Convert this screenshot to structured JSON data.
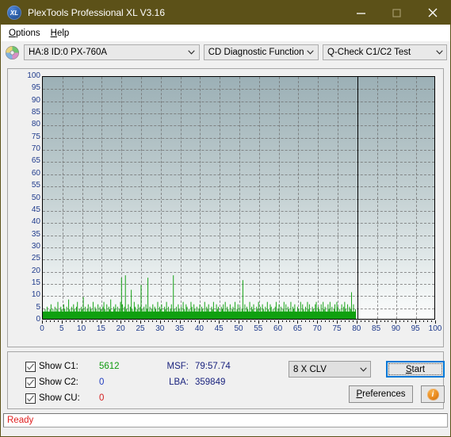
{
  "window": {
    "title": "PlexTools Professional XL V3.16",
    "app_icon": "XL",
    "icon_name": "plextools-xl-icon",
    "titlebar_color": "#5c5118",
    "controls": {
      "minimize": "minimize-icon",
      "maximize": "maximize-icon",
      "close": "close-icon"
    }
  },
  "menu": {
    "items": [
      {
        "label": "Options",
        "accel": "O",
        "rest": "ptions"
      },
      {
        "label": "Help",
        "accel": "H",
        "rest": "elp"
      }
    ]
  },
  "selectors": {
    "disc_icon": "cd-disc-icon",
    "drive": "HA:8 ID:0  PX-760A",
    "function": "CD Diagnostic Functions",
    "test": "Q-Check C1/C2 Test"
  },
  "controls": {
    "checkboxes": [
      {
        "label": "Show C1:",
        "checked": true,
        "value": "5612",
        "color": "#0f9b0f"
      },
      {
        "label": "Show C2:",
        "checked": true,
        "value": "0",
        "color": "#1f3bbf"
      },
      {
        "label": "Show CU:",
        "checked": true,
        "value": "0",
        "color": "#d42020"
      }
    ],
    "readouts": [
      {
        "key": "MSF:",
        "value": "79:57.74"
      },
      {
        "key": "LBA:",
        "value": "359849"
      }
    ],
    "speed": "8 X CLV",
    "start_label": "Start",
    "start_accel": "S",
    "preferences_label": "Preferences",
    "preferences_accel": "P",
    "info_glyph": "i"
  },
  "status": {
    "text": "Ready",
    "color": "#e02020"
  },
  "chart_data": {
    "type": "area",
    "title": "Q-Check C1/C2 Test",
    "xlabel": "",
    "ylabel": "",
    "xlim": [
      0,
      100
    ],
    "ylim": [
      0,
      100
    ],
    "xticks": [
      0,
      5,
      10,
      15,
      20,
      25,
      30,
      35,
      40,
      45,
      50,
      55,
      60,
      65,
      70,
      75,
      80,
      85,
      90,
      95,
      100
    ],
    "yticks": [
      0,
      5,
      10,
      15,
      20,
      25,
      30,
      35,
      40,
      45,
      50,
      55,
      60,
      65,
      70,
      75,
      80,
      85,
      90,
      95,
      100
    ],
    "grid": true,
    "legend": "none",
    "data_end_x": 80,
    "series": [
      {
        "name": "C1",
        "color": "#10a010",
        "x_start": 0,
        "x_end": 80,
        "n_points": 320,
        "baseline": 3,
        "typical_range": [
          2,
          9
        ],
        "peak_max": 18,
        "values": [
          3,
          2,
          4,
          3,
          5,
          3,
          2,
          4,
          6,
          3,
          4,
          2,
          5,
          3,
          4,
          7,
          3,
          2,
          5,
          4,
          3,
          6,
          4,
          2,
          5,
          3,
          8,
          4,
          3,
          5,
          2,
          6,
          4,
          3,
          5,
          7,
          3,
          4,
          2,
          5,
          4,
          9,
          3,
          5,
          2,
          4,
          6,
          3,
          5,
          4,
          2,
          7,
          3,
          5,
          4,
          3,
          6,
          2,
          5,
          4,
          3,
          5,
          7,
          4,
          2,
          6,
          3,
          5,
          4,
          8,
          3,
          2,
          5,
          4,
          6,
          3,
          5,
          2,
          4,
          7,
          17,
          6,
          3,
          5,
          18,
          4,
          2,
          6,
          3,
          5,
          12,
          4,
          3,
          7,
          5,
          2,
          4,
          6,
          3,
          5,
          14,
          4,
          2,
          5,
          3,
          6,
          4,
          17,
          3,
          5,
          2,
          4,
          6,
          3,
          5,
          4,
          2,
          7,
          3,
          5,
          4,
          6,
          3,
          2,
          5,
          4,
          7,
          3,
          5,
          2,
          4,
          6,
          3,
          18,
          4,
          2,
          5,
          3,
          6,
          4,
          3,
          5,
          2,
          7,
          4,
          3,
          6,
          5,
          2,
          4,
          3,
          7,
          5,
          2,
          6,
          4,
          3,
          5,
          2,
          4,
          6,
          3,
          5,
          4,
          2,
          7,
          3,
          5,
          4,
          6,
          2,
          3,
          5,
          4,
          7,
          3,
          2,
          6,
          4,
          5,
          3,
          2,
          5,
          4,
          6,
          3,
          7,
          2,
          5,
          4,
          3,
          6,
          2,
          4,
          5,
          3,
          7,
          2,
          4,
          6,
          3,
          5,
          2,
          4,
          16,
          3,
          6,
          2,
          5,
          4,
          3,
          7,
          2,
          5,
          4,
          6,
          3,
          2,
          5,
          4,
          7,
          3,
          5,
          2,
          6,
          4,
          3,
          5,
          2,
          7,
          4,
          3,
          6,
          5,
          2,
          4,
          3,
          5,
          7,
          2,
          4,
          6,
          3,
          5,
          2,
          4,
          7,
          3,
          6,
          2,
          5,
          4,
          3,
          7,
          2,
          5,
          4,
          6,
          3,
          2,
          5,
          4,
          3,
          7,
          2,
          6,
          4,
          3,
          5,
          2,
          7,
          4,
          6,
          3,
          2,
          5,
          4,
          3,
          6,
          7,
          2,
          5,
          4,
          3,
          6,
          2,
          7,
          4,
          5,
          3,
          2,
          6,
          4,
          7,
          3,
          5,
          2,
          4,
          6,
          3,
          7,
          5,
          2,
          4,
          3,
          6,
          2,
          5,
          7,
          4,
          3,
          6,
          2,
          5,
          4,
          11,
          3,
          6,
          2,
          4
        ]
      }
    ]
  }
}
